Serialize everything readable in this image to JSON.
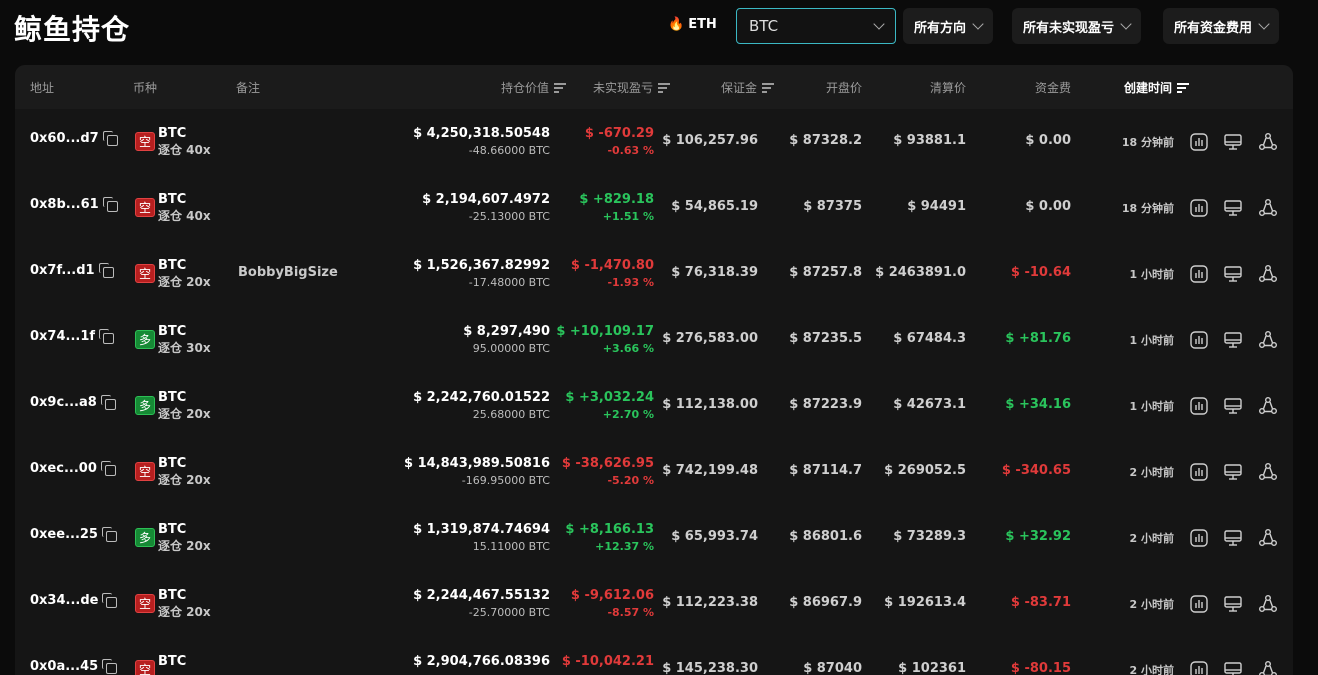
{
  "header": {
    "title": "鲸鱼持仓",
    "eth_label": "ETH",
    "symbol_value": "BTC",
    "filters": [
      "所有方向",
      "所有未实现盈亏",
      "所有资金费用"
    ]
  },
  "columns": {
    "address": "地址",
    "coin": "币种",
    "note": "备注",
    "value": "持仓价值",
    "pnl": "未实现盈亏",
    "margin": "保证金",
    "entry": "开盘价",
    "liq": "清算价",
    "funding": "资金费",
    "created": "创建时间"
  },
  "rows": [
    {
      "address": "0x60...d7",
      "side": "空",
      "side_type": "short",
      "coin": "BTC",
      "leverage": "逐仓 40x",
      "note": "",
      "value": "$ 4,250,318.50548",
      "size": "-48.66000 BTC",
      "pnl": "$ -670.29",
      "pnl_pct": "-0.63 %",
      "pnl_sign": "neg",
      "margin": "$ 106,257.96",
      "entry": "$ 87328.2",
      "liq": "$ 93881.1",
      "funding": "$ 0.00",
      "fund_sign": "zero",
      "created": "18 分钟前"
    },
    {
      "address": "0x8b...61",
      "side": "空",
      "side_type": "short",
      "coin": "BTC",
      "leverage": "逐仓 40x",
      "note": "",
      "value": "$ 2,194,607.4972",
      "size": "-25.13000 BTC",
      "pnl": "$ +829.18",
      "pnl_pct": "+1.51 %",
      "pnl_sign": "pos",
      "margin": "$ 54,865.19",
      "entry": "$ 87375",
      "liq": "$ 94491",
      "funding": "$ 0.00",
      "fund_sign": "zero",
      "created": "18 分钟前"
    },
    {
      "address": "0x7f...d1",
      "side": "空",
      "side_type": "short",
      "coin": "BTC",
      "leverage": "逐仓 20x",
      "note": "BobbyBigSize",
      "value": "$ 1,526,367.82992",
      "size": "-17.48000 BTC",
      "pnl": "$ -1,470.80",
      "pnl_pct": "-1.93 %",
      "pnl_sign": "neg",
      "margin": "$ 76,318.39",
      "entry": "$ 87257.8",
      "liq": "$ 2463891.0",
      "funding": "$ -10.64",
      "fund_sign": "neg",
      "created": "1 小时前"
    },
    {
      "address": "0x74...1f",
      "side": "多",
      "side_type": "long",
      "coin": "BTC",
      "leverage": "逐仓 30x",
      "note": "",
      "value": "$ 8,297,490",
      "size": "95.00000 BTC",
      "pnl": "$ +10,109.17",
      "pnl_pct": "+3.66 %",
      "pnl_sign": "pos",
      "margin": "$ 276,583.00",
      "entry": "$ 87235.5",
      "liq": "$ 67484.3",
      "funding": "$ +81.76",
      "fund_sign": "pos",
      "created": "1 小时前"
    },
    {
      "address": "0x9c...a8",
      "side": "多",
      "side_type": "long",
      "coin": "BTC",
      "leverage": "逐仓 20x",
      "note": "",
      "value": "$ 2,242,760.01522",
      "size": "25.68000 BTC",
      "pnl": "$ +3,032.24",
      "pnl_pct": "+2.70 %",
      "pnl_sign": "pos",
      "margin": "$ 112,138.00",
      "entry": "$ 87223.9",
      "liq": "$ 42673.1",
      "funding": "$ +34.16",
      "fund_sign": "pos",
      "created": "1 小时前"
    },
    {
      "address": "0xec...00",
      "side": "空",
      "side_type": "short",
      "coin": "BTC",
      "leverage": "逐仓 20x",
      "note": "",
      "value": "$ 14,843,989.50816",
      "size": "-169.95000 BTC",
      "pnl": "$ -38,626.95",
      "pnl_pct": "-5.20 %",
      "pnl_sign": "neg",
      "margin": "$ 742,199.48",
      "entry": "$ 87114.7",
      "liq": "$ 269052.5",
      "funding": "$ -340.65",
      "fund_sign": "neg",
      "created": "2 小时前"
    },
    {
      "address": "0xee...25",
      "side": "多",
      "side_type": "long",
      "coin": "BTC",
      "leverage": "逐仓 20x",
      "note": "",
      "value": "$ 1,319,874.74694",
      "size": "15.11000 BTC",
      "pnl": "$ +8,166.13",
      "pnl_pct": "+12.37 %",
      "pnl_sign": "pos",
      "margin": "$ 65,993.74",
      "entry": "$ 86801.6",
      "liq": "$ 73289.3",
      "funding": "$ +32.92",
      "fund_sign": "pos",
      "created": "2 小时前"
    },
    {
      "address": "0x34...de",
      "side": "空",
      "side_type": "short",
      "coin": "BTC",
      "leverage": "逐仓 20x",
      "note": "",
      "value": "$ 2,244,467.55132",
      "size": "-25.70000 BTC",
      "pnl": "$ -9,612.06",
      "pnl_pct": "-8.57 %",
      "pnl_sign": "neg",
      "margin": "$ 112,223.38",
      "entry": "$ 86967.9",
      "liq": "$ 192613.4",
      "funding": "$ -83.71",
      "fund_sign": "neg",
      "created": "2 小时前"
    },
    {
      "address": "0x0a...45",
      "side": "空",
      "side_type": "short",
      "coin": "BTC",
      "leverage": "",
      "note": "",
      "value": "$ 2,904,766.08396",
      "size": "",
      "pnl": "$ -10,042.21",
      "pnl_pct": "",
      "pnl_sign": "neg",
      "margin": "$ 145,238.30",
      "entry": "$ 87040",
      "liq": "$ 102361",
      "funding": "$ -80.15",
      "fund_sign": "neg",
      "created": "2 小时前"
    }
  ],
  "colors": {
    "accent": "#3bb8c4",
    "negative": "#e03a3a",
    "positive": "#2ac45c"
  },
  "icons": [
    "flame-icon",
    "chevron-down-icon",
    "sort-icon",
    "copy-icon",
    "chart-icon",
    "monitor-icon",
    "share-icon"
  ]
}
